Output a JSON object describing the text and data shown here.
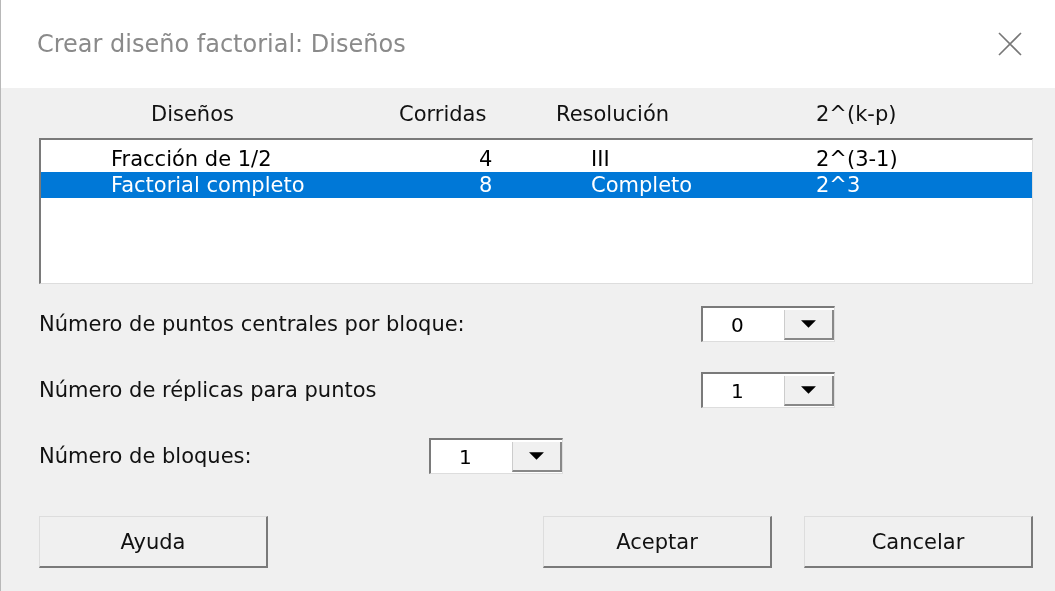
{
  "window": {
    "title": "Crear diseño factorial: Diseños"
  },
  "table": {
    "columns": [
      "Diseños",
      "Corridas",
      "Resolución",
      "2^(k-p)"
    ],
    "rows": [
      {
        "cells": [
          "Fracción de 1/2",
          "4",
          "III",
          "2^(3-1)"
        ],
        "selected": false
      },
      {
        "cells": [
          "Factorial completo",
          "8",
          "Completo",
          "2^3"
        ],
        "selected": true
      }
    ]
  },
  "fields": [
    {
      "label": "Número de puntos centrales por bloque:",
      "value": "0"
    },
    {
      "label": "Número de réplicas para puntos",
      "value": "1"
    },
    {
      "label": "Número de bloques:",
      "value": "1"
    }
  ],
  "buttons": [
    "Ayuda",
    "Aceptar",
    "Cancelar"
  ]
}
